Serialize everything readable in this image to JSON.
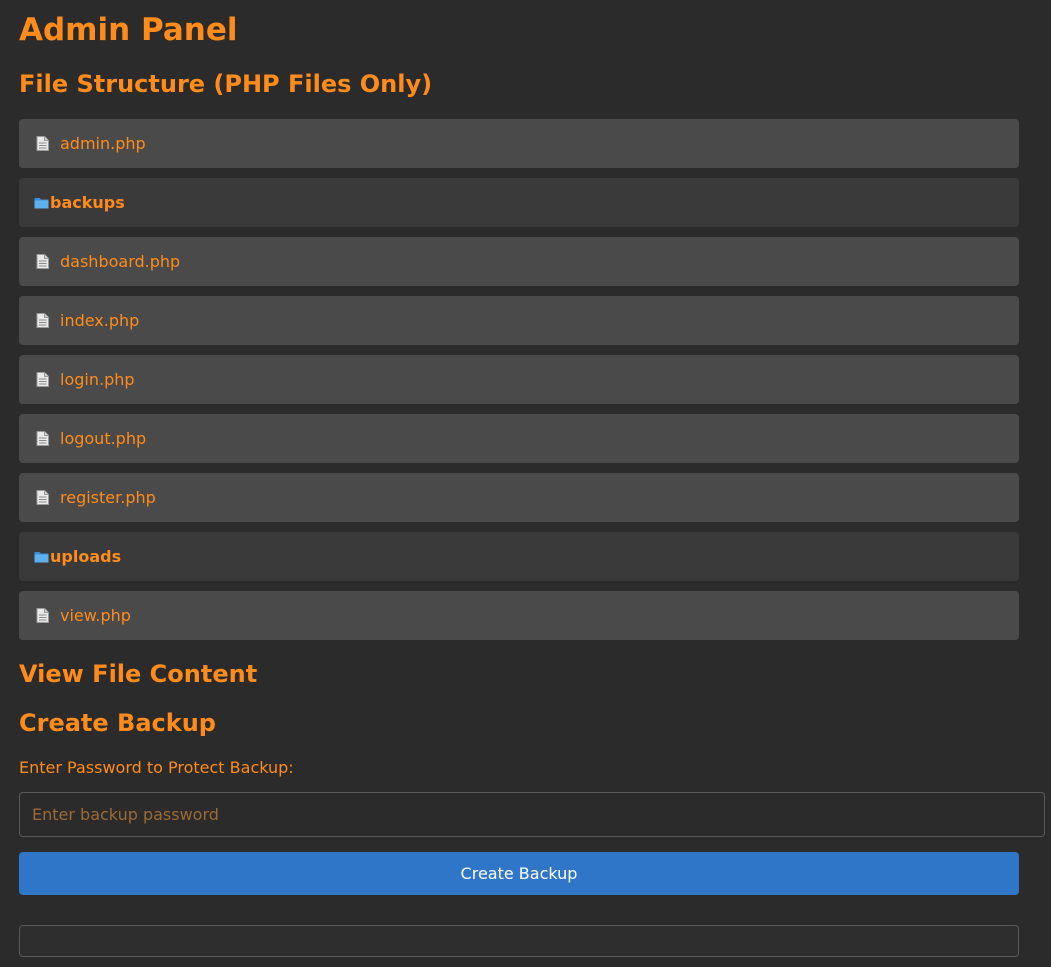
{
  "page": {
    "title": "Admin Panel"
  },
  "file_structure": {
    "heading": "File Structure (PHP Files Only)",
    "items": [
      {
        "type": "file",
        "name": "admin.php",
        "icon": "document-icon"
      },
      {
        "type": "folder",
        "name": "backups",
        "icon": "folder-icon"
      },
      {
        "type": "file",
        "name": "dashboard.php",
        "icon": "document-icon"
      },
      {
        "type": "file",
        "name": "index.php",
        "icon": "document-icon"
      },
      {
        "type": "file",
        "name": "login.php",
        "icon": "document-icon"
      },
      {
        "type": "file",
        "name": "logout.php",
        "icon": "document-icon"
      },
      {
        "type": "file",
        "name": "register.php",
        "icon": "document-icon"
      },
      {
        "type": "folder",
        "name": "uploads",
        "icon": "folder-icon"
      },
      {
        "type": "file",
        "name": "view.php",
        "icon": "document-icon"
      }
    ]
  },
  "view_file": {
    "heading": "View File Content"
  },
  "backup": {
    "heading": "Create Backup",
    "password_label": "Enter Password to Protect Backup:",
    "password_value": "",
    "password_placeholder": "Enter backup password",
    "button_label": "Create Backup",
    "output_text": ""
  },
  "colors": {
    "background": "#2b2b2b",
    "accent": "#ff8c1a",
    "file_row": "#4a4a4a",
    "folder_row": "#3a3a3a",
    "button": "#2f76c8"
  }
}
